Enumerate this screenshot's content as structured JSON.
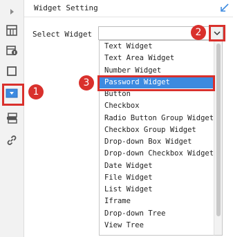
{
  "panel": {
    "title": "Widget Setting"
  },
  "form": {
    "select_label": "Select Widget",
    "select_value": ""
  },
  "dropdown": {
    "options": [
      "Text Widget",
      "Text Area Widget",
      "Number Widget",
      "Password Widget",
      "Button",
      "Checkbox",
      "Radio Button Group Widget",
      "Checkbox Group Widget",
      "Drop-down Box Widget",
      "Drop-down Checkbox Widget",
      "Date Widget",
      "File Widget",
      "List Widget",
      "Iframe",
      "Drop-down Tree",
      "View Tree"
    ],
    "selected": "Password Widget"
  },
  "callouts": [
    "1",
    "2",
    "3"
  ],
  "colors": {
    "accent": "#3d8ae0",
    "callout": "#d9302c",
    "sidebar_bg": "#f2f2f2"
  },
  "icons": [
    "expand-arrow-icon",
    "cell-attribute-icon",
    "cell-element-icon",
    "style-icon",
    "widget-icon",
    "condition-attribute-icon",
    "hyperlink-icon",
    "resize-icon",
    "chevron-down-icon"
  ]
}
